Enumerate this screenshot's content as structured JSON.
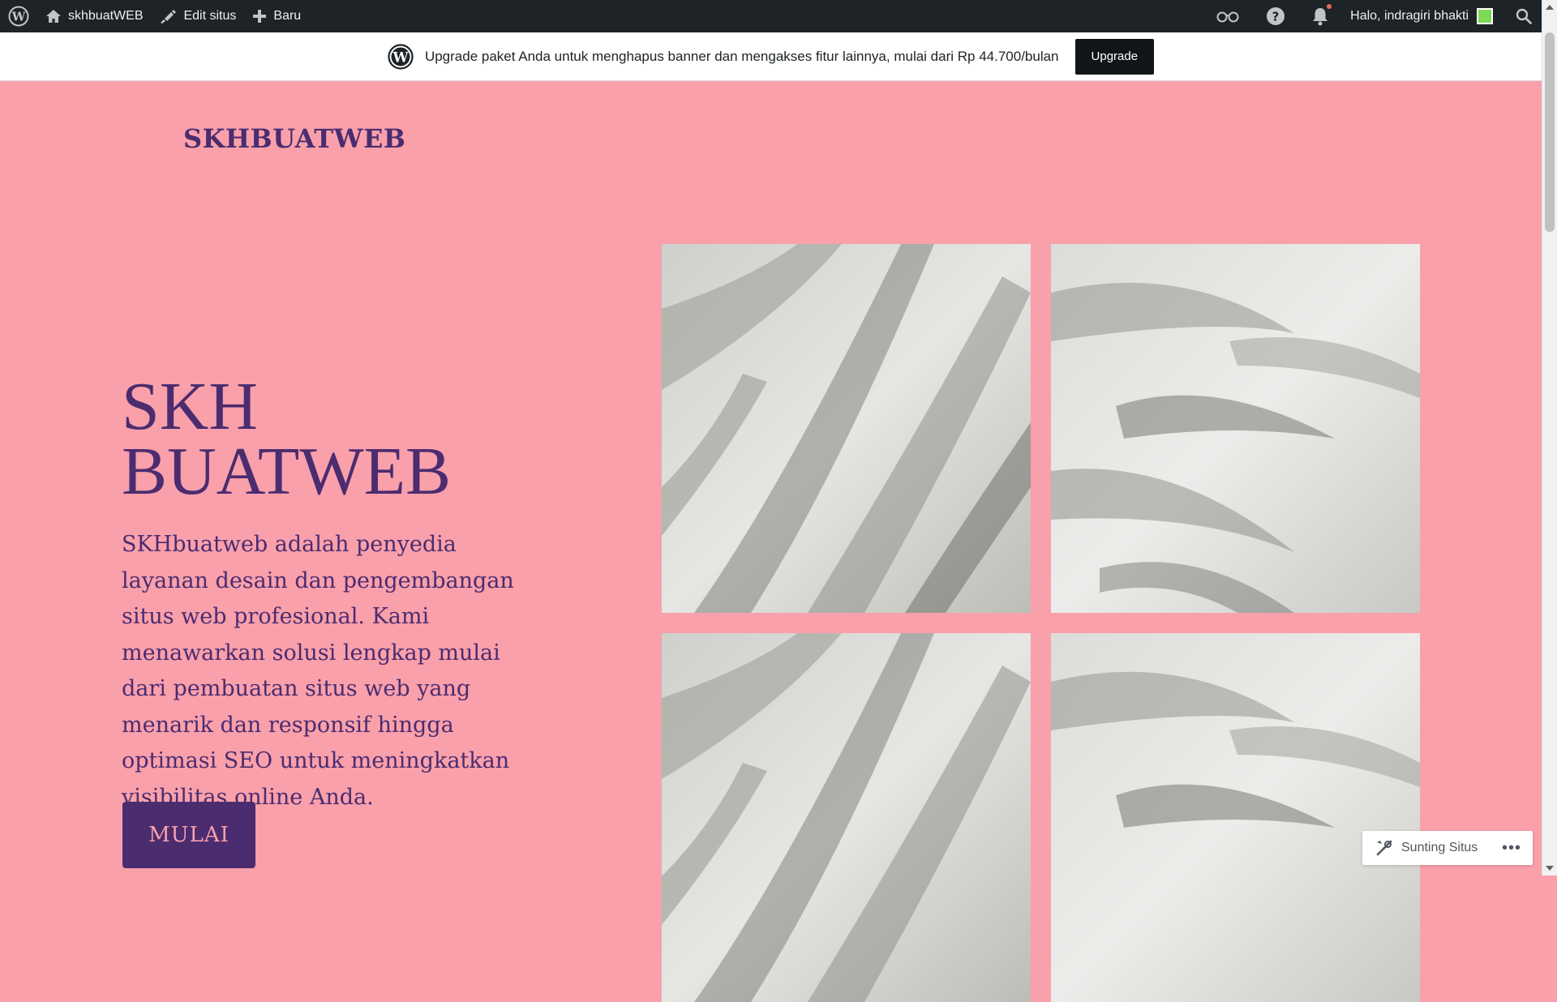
{
  "admin_bar": {
    "site_name": "skhbuatWEB",
    "edit_label": "Edit situs",
    "new_label": "Baru",
    "greeting": "Halo, indragiri bhakti"
  },
  "banner": {
    "text": "Upgrade paket Anda untuk menghapus banner dan mengakses fitur lainnya, mulai dari Rp 44.700/bulan",
    "button": "Upgrade"
  },
  "site": {
    "title": "SKHBUATWEB",
    "hero_line1": "SKH",
    "hero_line2": "BUATWEB",
    "description": "SKHbuatweb adalah penyedia layanan desain dan pengembangan situs web profesional. Kami menawarkan solusi lengkap mulai dari pembuatan situs web yang menarik dan responsif hingga optimasi SEO untuk meningkatkan visibilitas online Anda.",
    "cta": "MULAI"
  },
  "edit_pill": {
    "label": "Sunting Situs"
  },
  "colors": {
    "background": "#f9a0ab",
    "accent": "#4b2c6f",
    "admin_bar": "#1d2327"
  },
  "icons": [
    "wordpress-icon",
    "home-icon",
    "edit-icon",
    "plus-icon",
    "reader-icon",
    "help-icon",
    "bell-icon",
    "search-icon",
    "tools-icon",
    "more-icon"
  ]
}
